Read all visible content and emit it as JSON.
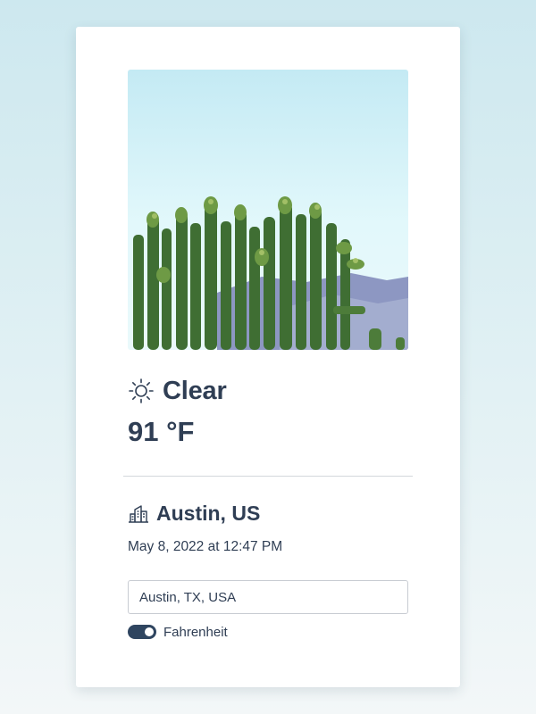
{
  "weather": {
    "condition": "Clear",
    "condition_icon": "sun-icon",
    "temperature": "91 °F"
  },
  "location": {
    "name": "Austin, US",
    "icon": "city-buildings-icon",
    "datetime": "May 8, 2022 at 12:47 PM"
  },
  "search": {
    "value": "Austin, TX, USA"
  },
  "units": {
    "toggle_label": "Fahrenheit",
    "fahrenheit_enabled": true
  },
  "colors": {
    "text": "#2f3e54",
    "toggle_on": "#2f4560",
    "card_background": "#ffffff"
  }
}
